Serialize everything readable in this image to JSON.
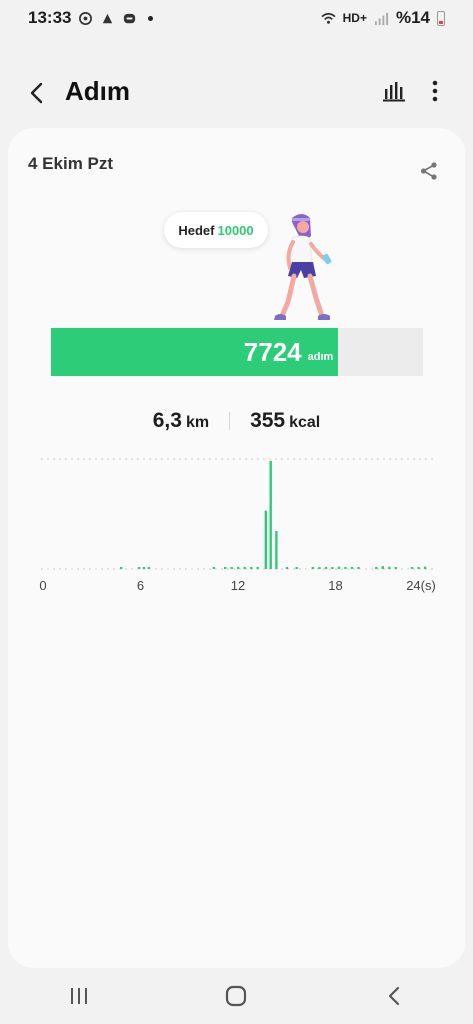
{
  "status_bar": {
    "time": "13:33",
    "network": "HD+",
    "battery": "%14",
    "icons": [
      "whatsapp-icon",
      "lens-icon",
      "messenger-icon",
      "wifi-icon",
      "signal-icon",
      "battery-icon"
    ]
  },
  "header": {
    "title": "Adım",
    "back_icon": "back-arrow-icon",
    "chart_icon": "bar-chart-icon",
    "more_icon": "more-vert-icon"
  },
  "summary": {
    "date": "4 Ekim Pzt",
    "goal_label": "Hedef",
    "goal_value": "10000",
    "steps": "7724",
    "steps_unit": "adım",
    "progress_fraction": 0.7724,
    "distance_value": "6,3",
    "distance_unit": "km",
    "calories_value": "355",
    "calories_unit": "kcal",
    "accent_color": "#2dcc79"
  },
  "chart_data": {
    "type": "bar",
    "x_ticks": [
      "0",
      "6",
      "12",
      "18",
      "24(s)"
    ],
    "xlim": [
      0,
      24
    ],
    "grid": false,
    "values": [
      {
        "x": 4.8,
        "y": 30
      },
      {
        "x": 5.9,
        "y": 20
      },
      {
        "x": 6.2,
        "y": 20
      },
      {
        "x": 6.5,
        "y": 20
      },
      {
        "x": 10.5,
        "y": 20
      },
      {
        "x": 11.2,
        "y": 20
      },
      {
        "x": 11.6,
        "y": 20
      },
      {
        "x": 12.0,
        "y": 20
      },
      {
        "x": 12.4,
        "y": 30
      },
      {
        "x": 12.8,
        "y": 25
      },
      {
        "x": 13.2,
        "y": 30
      },
      {
        "x": 13.7,
        "y": 1000
      },
      {
        "x": 14.0,
        "y": 1850
      },
      {
        "x": 14.35,
        "y": 650
      },
      {
        "x": 15.0,
        "y": 25
      },
      {
        "x": 15.6,
        "y": 25
      },
      {
        "x": 16.6,
        "y": 20
      },
      {
        "x": 17.0,
        "y": 25
      },
      {
        "x": 17.4,
        "y": 25
      },
      {
        "x": 17.8,
        "y": 30
      },
      {
        "x": 18.2,
        "y": 40
      },
      {
        "x": 18.6,
        "y": 30
      },
      {
        "x": 19.0,
        "y": 25
      },
      {
        "x": 19.4,
        "y": 25
      },
      {
        "x": 20.5,
        "y": 30
      },
      {
        "x": 20.9,
        "y": 50
      },
      {
        "x": 21.3,
        "y": 40
      },
      {
        "x": 21.7,
        "y": 25
      },
      {
        "x": 22.7,
        "y": 30
      },
      {
        "x": 23.1,
        "y": 30
      },
      {
        "x": 23.5,
        "y": 40
      }
    ]
  },
  "nav_bar": {
    "icons": [
      "recent-apps-icon",
      "home-icon",
      "nav-back-icon"
    ]
  }
}
